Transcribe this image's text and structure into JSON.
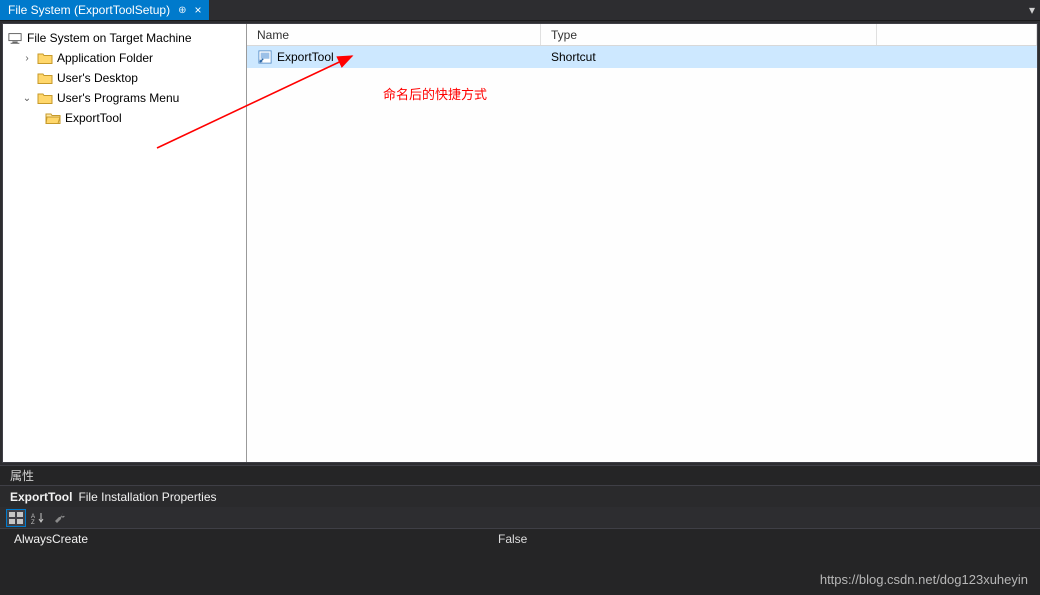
{
  "tab": {
    "title": "File System (ExportToolSetup)"
  },
  "tree": {
    "root": "File System on Target Machine",
    "items": [
      {
        "label": "Application Folder",
        "expander": "›"
      },
      {
        "label": "User's Desktop",
        "expander": ""
      },
      {
        "label": "User's Programs Menu",
        "expander": "⌄"
      },
      {
        "label": "ExportTool",
        "expander": ""
      }
    ]
  },
  "list": {
    "headers": {
      "name": "Name",
      "type": "Type"
    },
    "rows": [
      {
        "name": "ExportTool",
        "type": "Shortcut"
      }
    ]
  },
  "annotation": "命名后的快捷方式",
  "props": {
    "panel_title": "属性",
    "subject": "ExportTool",
    "subject_desc": "File Installation Properties",
    "rows": [
      {
        "k": "AlwaysCreate",
        "v": "False"
      }
    ]
  },
  "watermark": "https://blog.csdn.net/dog123xuheyin"
}
